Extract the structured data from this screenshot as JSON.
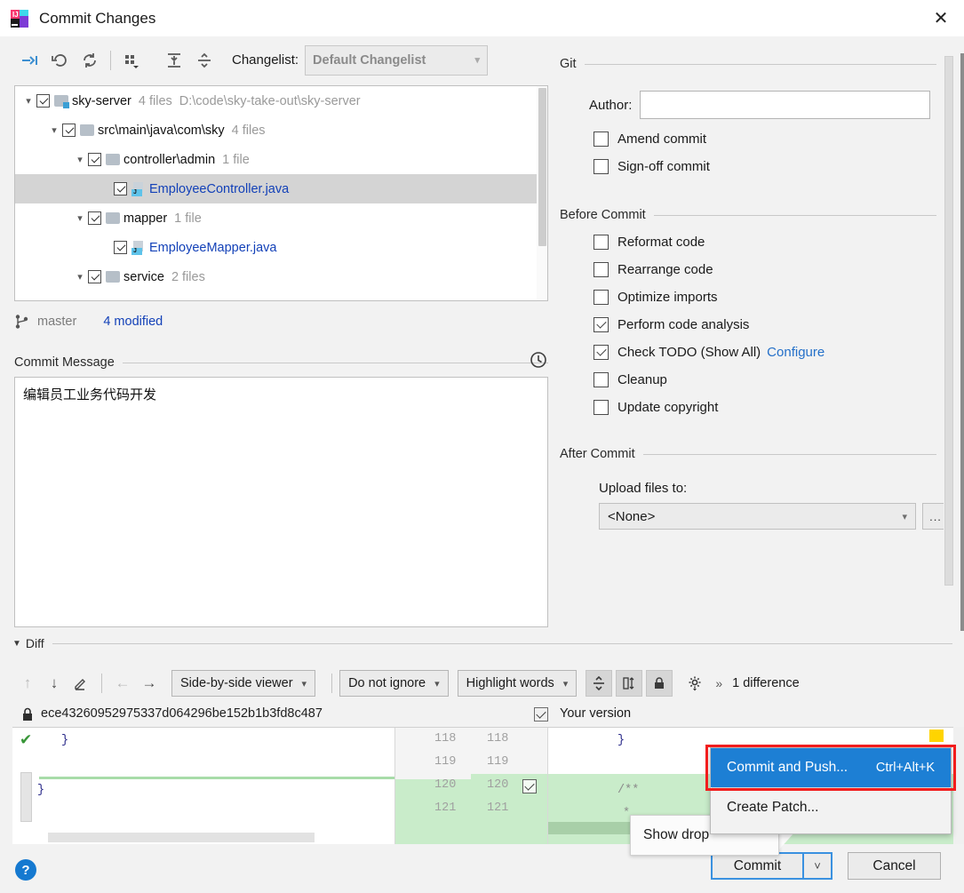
{
  "window": {
    "title": "Commit Changes",
    "app_icon": "intellij-idea-icon",
    "close_label": "✕"
  },
  "toolbar": {
    "icons": [
      {
        "name": "show-diff-icon",
        "glyph": "➔"
      },
      {
        "name": "revert-icon",
        "glyph": "↶"
      },
      {
        "name": "refresh-icon",
        "glyph": "⟳"
      },
      {
        "name": "group-by-icon",
        "glyph": "∷"
      },
      {
        "name": "expand-all-icon",
        "glyph": "⧉"
      },
      {
        "name": "collapse-all-icon",
        "glyph": "⧉"
      }
    ],
    "changelist_label": "Changelist:",
    "changelist_value": "Default Changelist"
  },
  "tree": {
    "rows": [
      {
        "indent": 0,
        "arrow": "˅",
        "checked": true,
        "icon": "folder-module",
        "name": "sky-server",
        "meta": "4 files",
        "path": "D:\\code\\sky-take-out\\sky-server",
        "blue": false,
        "selected": false
      },
      {
        "indent": 1,
        "arrow": "˅",
        "checked": true,
        "icon": "folder",
        "name": "src\\main\\java\\com\\sky",
        "meta": "4 files",
        "path": "",
        "blue": false,
        "selected": false
      },
      {
        "indent": 2,
        "arrow": "˅",
        "checked": true,
        "icon": "folder",
        "name": "controller\\admin",
        "meta": "1 file",
        "path": "",
        "blue": false,
        "selected": false
      },
      {
        "indent": 3,
        "arrow": "",
        "checked": true,
        "icon": "java",
        "name": "EmployeeController.java",
        "meta": "",
        "path": "",
        "blue": true,
        "selected": true
      },
      {
        "indent": 2,
        "arrow": "˅",
        "checked": true,
        "icon": "folder",
        "name": "mapper",
        "meta": "1 file",
        "path": "",
        "blue": false,
        "selected": false
      },
      {
        "indent": 3,
        "arrow": "",
        "checked": true,
        "icon": "java",
        "name": "EmployeeMapper.java",
        "meta": "",
        "path": "",
        "blue": true,
        "selected": false
      },
      {
        "indent": 2,
        "arrow": "˅",
        "checked": true,
        "icon": "folder",
        "name": "service",
        "meta": "2 files",
        "path": "",
        "blue": false,
        "selected": false
      }
    ]
  },
  "branch": {
    "icon": "git-branch-icon",
    "name": "master",
    "modified_label": "4 modified"
  },
  "commit_message": {
    "section_label": "Commit Message",
    "history_icon": "clock-icon",
    "value": "编辑员工业务代码开发"
  },
  "git_section": {
    "title": "Git",
    "author_label": "Author:",
    "author_value": "",
    "checkboxes": [
      {
        "label": "Amend commit",
        "checked": false
      },
      {
        "label": "Sign-off commit",
        "checked": false
      }
    ]
  },
  "before_commit": {
    "title": "Before Commit",
    "checkboxes": [
      {
        "label": "Reformat code",
        "checked": false
      },
      {
        "label": "Rearrange code",
        "checked": false
      },
      {
        "label": "Optimize imports",
        "checked": false
      },
      {
        "label": "Perform code analysis",
        "checked": true
      },
      {
        "label": "Check TODO (Show All)",
        "checked": true,
        "link": "Configure"
      },
      {
        "label": "Cleanup",
        "checked": false
      },
      {
        "label": "Update copyright",
        "checked": false
      }
    ]
  },
  "after_commit": {
    "title": "After Commit",
    "upload_label": "Upload files to:",
    "upload_value": "<None>",
    "browse_label": "..."
  },
  "diff": {
    "section_label": "Diff",
    "viewer_mode": "Side-by-side viewer",
    "ignore_mode": "Do not ignore",
    "highlight_mode": "Highlight words",
    "difference_count": "1 difference",
    "left_title": "ece43260952975337d064296be152b1b3fd8c487",
    "right_title": "Your version",
    "right_checked": true,
    "left_lines": [
      "}",
      "",
      "}"
    ],
    "line_numbers_left": [
      "118",
      "119",
      "120",
      "121"
    ],
    "line_numbers_right": [
      "118",
      "119",
      "120",
      "121"
    ],
    "right_lines": [
      "}",
      "",
      "/**",
      "*"
    ]
  },
  "popup": {
    "items": [
      {
        "label": "Commit and Push...",
        "shortcut": "Ctrl+Alt+K",
        "active": true
      },
      {
        "label": "Create Patch...",
        "shortcut": "",
        "active": false
      }
    ]
  },
  "tooltip": {
    "text": "Show drop"
  },
  "footer": {
    "help_label": "?",
    "commit_label": "Commit",
    "commit_caret": "˅",
    "cancel_label": "Cancel"
  },
  "colors": {
    "accent_blue": "#1d7fd4",
    "link_blue": "#2470c9",
    "highlight_red": "#f21d1d",
    "diff_green": "#c9ecca",
    "dialog_bg": "#f2f2f2"
  }
}
